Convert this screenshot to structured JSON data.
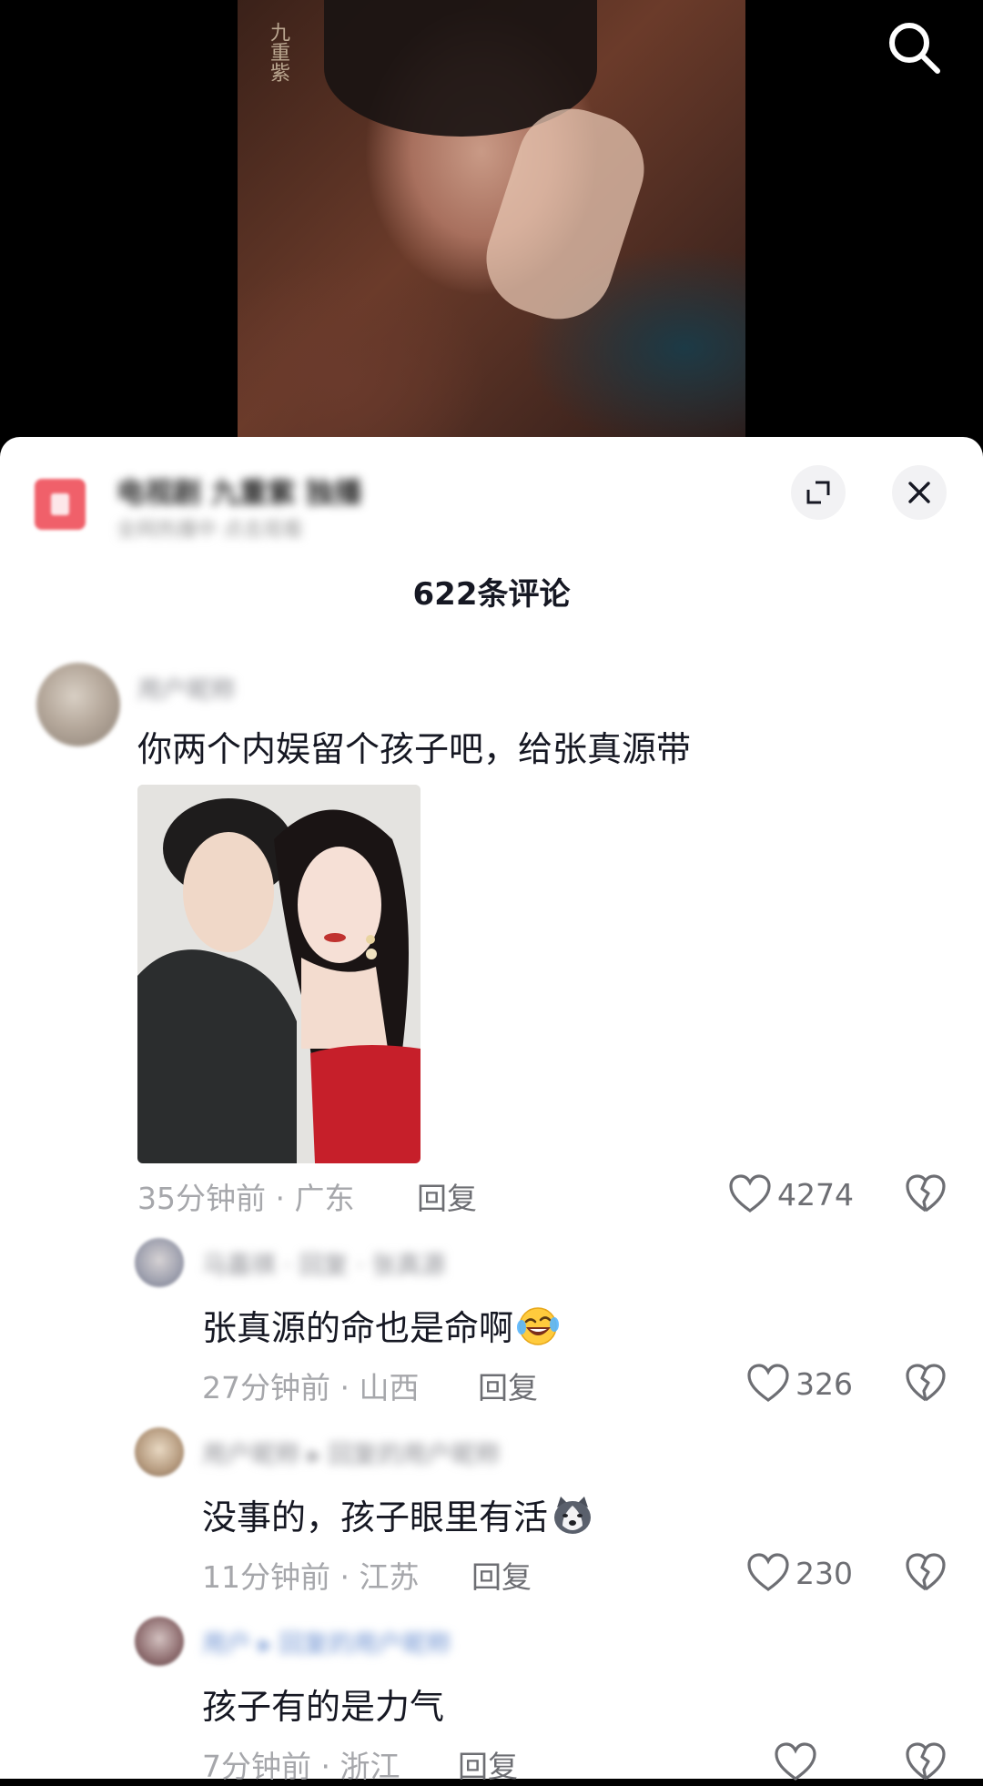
{
  "video": {
    "watermark": "九重紫"
  },
  "icons": {
    "search": "search-icon",
    "expand": "expand-icon",
    "close": "close-icon",
    "like": "heart-outline-icon",
    "dislike": "broken-heart-icon"
  },
  "sheet": {
    "channel_name": "电视剧 九重紫 独播",
    "channel_sub": "全网热播中 点击观看",
    "comment_count": "622条评论"
  },
  "comments": [
    {
      "user": "用户昵称",
      "text": "你两个内娱留个孩子吧，给张真源带",
      "time": "35分钟前 · 广东",
      "reply_label": "回复",
      "likes": "4274"
    }
  ],
  "replies": [
    {
      "user": "马嘉祺 · 回复 · 张真源",
      "text": "张真源的命也是命啊",
      "emoji": "rofl-emoji",
      "time": "27分钟前 · 山西",
      "reply_label": "回复",
      "likes": "326"
    },
    {
      "user": "用户昵称 ▸ 回复的用户昵称",
      "text": "没事的，孩子眼里有活",
      "emoji": "husky-emoji",
      "time": "11分钟前 · 江苏",
      "reply_label": "回复",
      "likes": "230"
    },
    {
      "user": "用户 ▸ 回复的用户昵称",
      "text": "孩子有的是力气",
      "time": "7分钟前 · 浙江",
      "reply_label": "回复",
      "likes": ""
    }
  ]
}
